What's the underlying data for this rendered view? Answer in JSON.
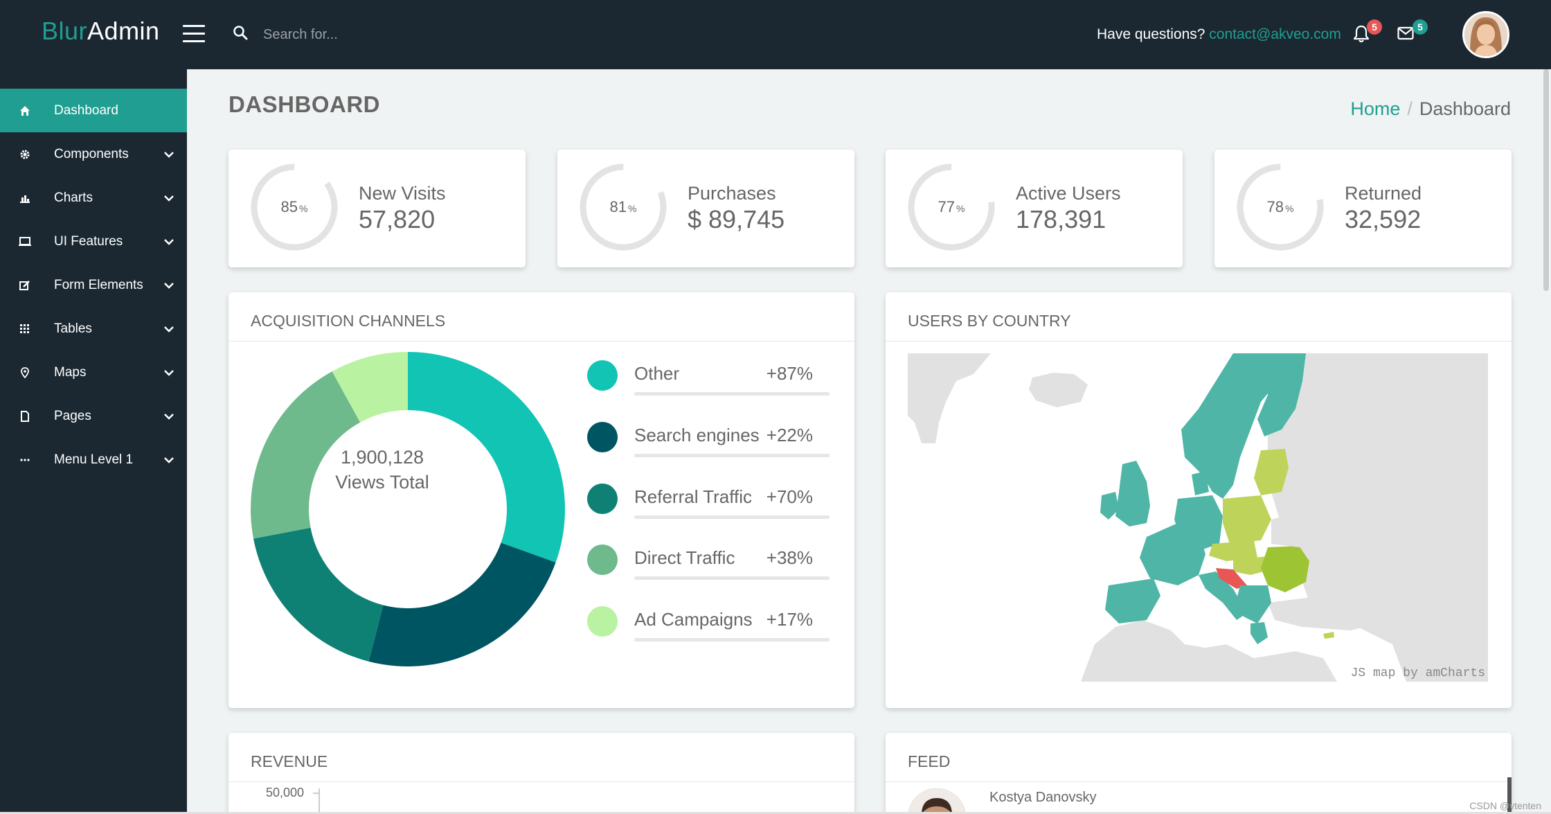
{
  "brand": {
    "part1": "Blur",
    "part2": "Admin"
  },
  "search": {
    "placeholder": "Search for..."
  },
  "header": {
    "questions": "Have questions?",
    "email": "contact@akveo.com",
    "notifications_count": "5",
    "messages_count": "5"
  },
  "sidebar": {
    "items": [
      {
        "label": "Dashboard",
        "icon": "home-icon",
        "active": true
      },
      {
        "label": "Components",
        "icon": "gear-icon"
      },
      {
        "label": "Charts",
        "icon": "bar-chart-icon"
      },
      {
        "label": "UI Features",
        "icon": "monitor-icon"
      },
      {
        "label": "Form Elements",
        "icon": "edit-icon"
      },
      {
        "label": "Tables",
        "icon": "grid-icon"
      },
      {
        "label": "Maps",
        "icon": "map-pin-icon"
      },
      {
        "label": "Pages",
        "icon": "file-icon"
      },
      {
        "label": "Menu Level 1",
        "icon": "more-icon"
      }
    ]
  },
  "page": {
    "title": "DASHBOARD"
  },
  "breadcrumb": {
    "home": "Home",
    "current": "Dashboard"
  },
  "stats": [
    {
      "percent": "85",
      "label": "New Visits",
      "value": "57,820"
    },
    {
      "percent": "81",
      "label": "Purchases",
      "value": "$ 89,745"
    },
    {
      "percent": "77",
      "label": "Active Users",
      "value": "178,391"
    },
    {
      "percent": "78",
      "label": "Returned",
      "value": "32,592"
    }
  ],
  "percent_sign": "%",
  "acquisition": {
    "title": "ACQUISITION CHANNELS",
    "total": "1,900,128",
    "total_label": "Views Total",
    "channels": [
      {
        "name": "Other",
        "percent": "+87%",
        "color": "#11c4b4",
        "share": 0.305
      },
      {
        "name": "Search engines",
        "percent": "+22%",
        "color": "#005562",
        "share": 0.235
      },
      {
        "name": "Referral Traffic",
        "percent": "+70%",
        "color": "#0e8174",
        "share": 0.18
      },
      {
        "name": "Direct Traffic",
        "percent": "+38%",
        "color": "#6eba8c",
        "share": 0.2
      },
      {
        "name": "Ad Campaigns",
        "percent": "+17%",
        "color": "#b9f2a1",
        "share": 0.08
      }
    ]
  },
  "country": {
    "title": "USERS BY COUNTRY",
    "credit": "JS map by amCharts"
  },
  "revenue": {
    "title": "REVENUE",
    "y_tick": "50,000"
  },
  "feed": {
    "title": "FEED",
    "first_author": "Kostya Danovsky"
  },
  "watermark": "CSDN @vtenten"
}
